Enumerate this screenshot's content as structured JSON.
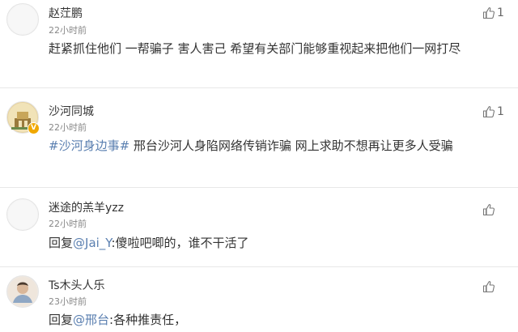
{
  "comments": [
    {
      "name": "赵茳鹏",
      "time": "22小时前",
      "text": "赶紧抓住他们 一帮骗子 害人害己 希望有关部门能够重视起来把他们一网打尽",
      "likes": "1"
    },
    {
      "name": "沙河同城",
      "time": "22小时前",
      "hashtag": "#沙河身边事#",
      "text": " 邢台沙河人身陷网络传销诈骗 网上求助不想再让更多人受骗",
      "likes": "1"
    },
    {
      "name": "迷途的羔羊yzz",
      "time": "22小时前",
      "reply_prefix": "回复",
      "mention": "@Jai_Y",
      "text": ":傻啦吧唧的，谁不干活了"
    },
    {
      "name": "Ts木头人乐",
      "time": "23小时前",
      "reply_prefix": "回复",
      "mention": "@邢台",
      "text": ":各种推责任，"
    }
  ],
  "badge": {
    "verified_symbol": "V"
  },
  "icons": {
    "like": "thumbs-up-icon"
  }
}
